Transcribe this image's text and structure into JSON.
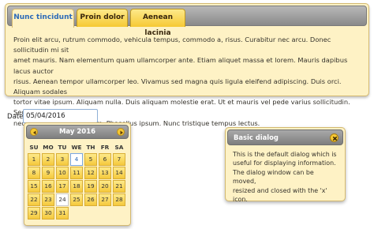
{
  "tabs": {
    "items": [
      {
        "label": "Nunc tincidunt"
      },
      {
        "label": "Proin dolor"
      },
      {
        "label": "Aenean lacinia"
      }
    ],
    "panel_lines": [
      "Proin elit arcu, rutrum commodo, vehicula tempus, commodo a, risus. Curabitur nec arcu. Donec sollicitudin mi sit",
      "amet mauris. Nam elementum quam ullamcorper ante. Etiam aliquet massa et lorem. Mauris dapibus lacus auctor",
      "risus. Aenean tempor ullamcorper leo. Vivamus sed magna quis ligula eleifend adipiscing. Duis orci. Aliquam sodales",
      "tortor vitae ipsum. Aliquam nulla. Duis aliquam molestie erat. Ut et mauris vel pede varius sollicitudin. Sed ut dolor",
      "nec orci tincidunt interdum. Phasellus ipsum. Nunc tristique tempus lectus."
    ]
  },
  "date": {
    "label": "Date:",
    "value": "05/04/2016"
  },
  "datepicker": {
    "month_title": "May 2016",
    "weekdays": [
      "SU",
      "MO",
      "TU",
      "WE",
      "TH",
      "FR",
      "SA"
    ],
    "weeks": [
      [
        "1",
        "2",
        "3",
        "4",
        "5",
        "6",
        "7"
      ],
      [
        "8",
        "9",
        "10",
        "11",
        "12",
        "13",
        "14"
      ],
      [
        "15",
        "16",
        "17",
        "18",
        "19",
        "20",
        "21"
      ],
      [
        "22",
        "23",
        "24",
        "25",
        "26",
        "27",
        "28"
      ],
      [
        "29",
        "30",
        "31",
        "",
        "",
        "",
        ""
      ]
    ],
    "selected_day": "4",
    "today_day": "24"
  },
  "dialog": {
    "title": "Basic dialog",
    "body_lines": [
      "This is the default dialog which is",
      "useful for displaying information.",
      "The dialog window can be moved,",
      "resized and closed with the 'x' icon."
    ]
  }
}
